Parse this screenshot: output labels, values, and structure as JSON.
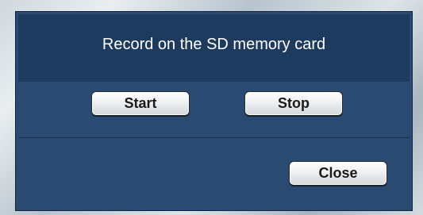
{
  "dialog": {
    "title": "Record on the SD memory card",
    "buttons": {
      "start_label": "Start",
      "stop_label": "Stop",
      "close_label": "Close"
    }
  },
  "colors": {
    "dialog_background": "#2b4a72",
    "header_background": "#1d3a5f",
    "title_text": "#ffffff"
  }
}
